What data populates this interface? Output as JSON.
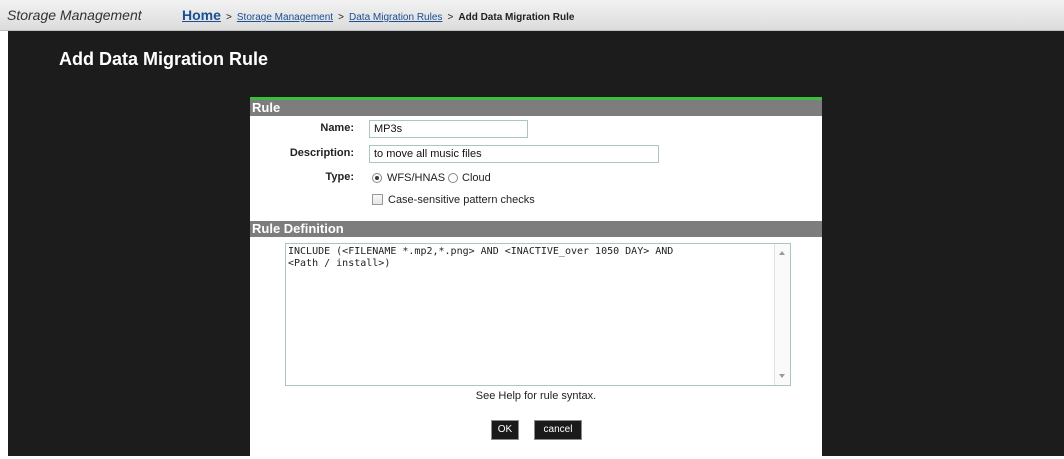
{
  "header": {
    "app_title": "Storage Management",
    "breadcrumb": {
      "home": "Home",
      "separator": ">",
      "items": [
        "Storage Management",
        "Data Migration Rules"
      ],
      "current": "Add Data Migration Rule"
    }
  },
  "page": {
    "title": "Add Data Migration Rule"
  },
  "rule_section": {
    "header": "Rule",
    "name_label": "Name:",
    "name_value": "MP3s",
    "description_label": "Description:",
    "description_value": "to move all music files",
    "type_label": "Type:",
    "type_options": [
      "WFS/HNAS",
      "Cloud"
    ],
    "type_selected": "WFS/HNAS",
    "case_sensitive_label": "Case-sensitive pattern checks",
    "case_sensitive_checked": false
  },
  "rule_definition": {
    "header": "Rule Definition",
    "text": "INCLUDE (<FILENAME *.mp2,*.png> AND <INACTIVE_over 1050 DAY> AND\n<Path / install>)",
    "help": "See Help for rule syntax."
  },
  "buttons": {
    "ok": "OK",
    "cancel": "cancel"
  },
  "colors": {
    "accent_green": "#3cbd3c",
    "section_header": "#7d7d7d",
    "background": "#1c1c1c",
    "link": "#1b4f91"
  }
}
